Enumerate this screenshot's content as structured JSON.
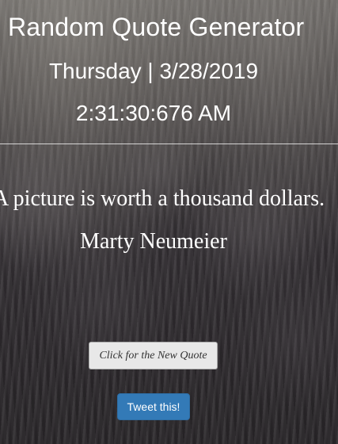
{
  "header": {
    "title": "Random Quote Generator",
    "date": "Thursday | 3/28/2019",
    "time": "2:31:30:676 AM"
  },
  "quote": {
    "text": "A picture is worth a thousand dollars.",
    "author": "Marty Neumeier"
  },
  "buttons": {
    "new_quote_label": "Click for the New Quote",
    "tweet_label": "Tweet this!"
  },
  "colors": {
    "text": "#ffffff",
    "tweet_button": "#337ab7",
    "new_quote_button": "#e8e8e8"
  }
}
